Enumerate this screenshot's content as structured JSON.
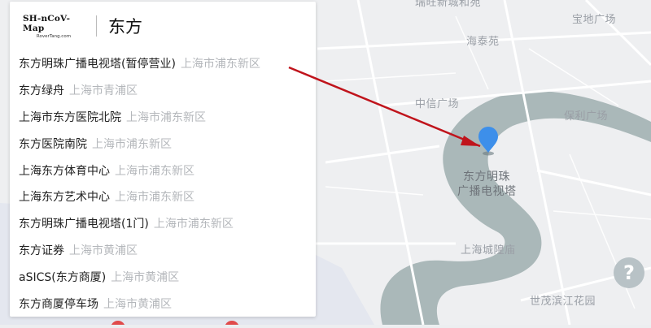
{
  "logo": {
    "title": "SH-nCoV-Map",
    "subtitle": "RoverTang.com"
  },
  "search": {
    "query": "东方"
  },
  "results": [
    {
      "name": "东方明珠广播电视塔(暂停营业)",
      "district": "上海市浦东新区"
    },
    {
      "name": "东方绿舟",
      "district": "上海市青浦区"
    },
    {
      "name": "上海市东方医院北院",
      "district": "上海市浦东新区"
    },
    {
      "name": "东方医院南院",
      "district": "上海市浦东新区"
    },
    {
      "name": "上海东方体育中心",
      "district": "上海市浦东新区"
    },
    {
      "name": "上海东方艺术中心",
      "district": "上海市浦东新区"
    },
    {
      "name": "东方明珠广播电视塔(1门)",
      "district": "上海市浦东新区"
    },
    {
      "name": "东方证券",
      "district": "上海市黄浦区"
    },
    {
      "name": "aSICS(东方商厦)",
      "district": "上海市黄浦区"
    },
    {
      "name": "东方商厦停车场",
      "district": "上海市黄浦区"
    }
  ],
  "map": {
    "labels": {
      "top_cut": "瑞旺新城和苑",
      "baodi": "宝地广场",
      "haitai": "海泰苑",
      "zhongxin": "中信广场",
      "poly": "保利广场",
      "pearl_line1": "东方明珠",
      "pearl_line2": "广播电视塔",
      "chenghuang": "上海城隍庙",
      "binjiang": "世茂滨江花园"
    },
    "marker_color": "#3d8fea",
    "arrow_color": "#c0141c",
    "river_color": "#aab8b9"
  },
  "help": {
    "label": "?"
  }
}
